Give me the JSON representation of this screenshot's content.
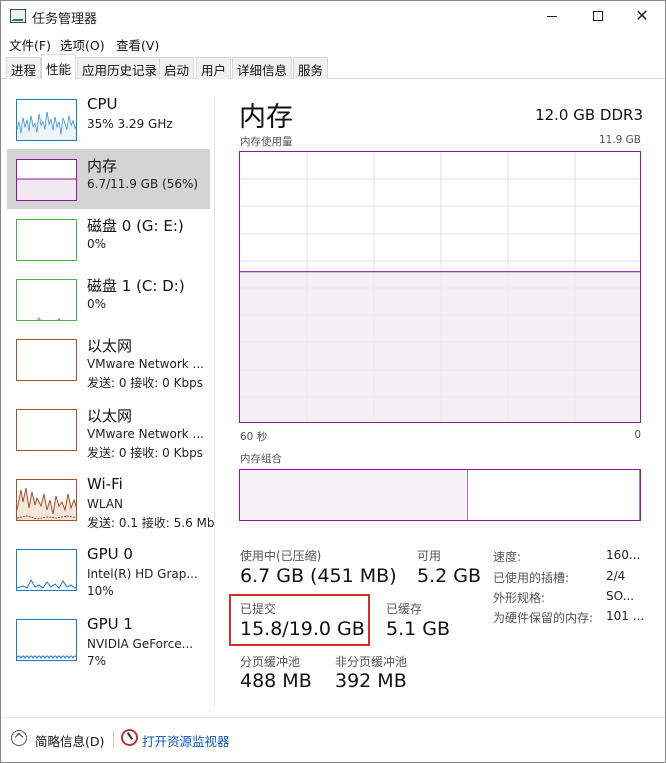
{
  "window": {
    "title": "任务管理器",
    "minimize_glyph": "—",
    "maximize_glyph": "☐",
    "close_glyph": "✕"
  },
  "menu": {
    "items": [
      "文件(F)",
      "选项(O)",
      "查看(V)"
    ]
  },
  "tabs": [
    {
      "label": "进程",
      "active": false
    },
    {
      "label": "性能",
      "active": true
    },
    {
      "label": "应用历史记录",
      "active": false
    },
    {
      "label": "启动",
      "active": false
    },
    {
      "label": "用户",
      "active": false
    },
    {
      "label": "详细信息",
      "active": false
    },
    {
      "label": "服务",
      "active": false
    }
  ],
  "sidebar": {
    "items": [
      {
        "title": "CPU",
        "line1": "35% 3.29 GHz",
        "line2": "",
        "color": "#1a7cc7",
        "icon": "cpu-graph-icon"
      },
      {
        "title": "内存",
        "line1": "6.7/11.9 GB (56%)",
        "line2": "",
        "color": "#8b1a9b",
        "icon": "memory-graph-icon",
        "selected": true
      },
      {
        "title": "磁盘 0 (G: E:)",
        "line1": "0%",
        "line2": "",
        "color": "#4caf50",
        "icon": "disk-graph-icon"
      },
      {
        "title": "磁盘 1 (C: D:)",
        "line1": "0%",
        "line2": "",
        "color": "#4caf50",
        "icon": "disk-graph-icon"
      },
      {
        "title": "以太网",
        "line1": "VMware Network ...",
        "line2": "发送: 0 接收: 0 Kbps",
        "color": "#a0522d",
        "icon": "ethernet-graph-icon"
      },
      {
        "title": "以太网",
        "line1": "VMware Network ...",
        "line2": "发送: 0 接收: 0 Kbps",
        "color": "#a0522d",
        "icon": "ethernet-graph-icon"
      },
      {
        "title": "Wi-Fi",
        "line1": "WLAN",
        "line2": "发送: 0.1 接收: 5.6 Mb",
        "color": "#a0522d",
        "icon": "wifi-graph-icon"
      },
      {
        "title": "GPU 0",
        "line1": "Intel(R) HD Grap...",
        "line2": "10%",
        "color": "#1a7cc7",
        "icon": "gpu-graph-icon"
      },
      {
        "title": "GPU 1",
        "line1": "NVIDIA GeForce...",
        "line2": "7%",
        "color": "#1a7cc7",
        "icon": "gpu-graph-icon"
      }
    ]
  },
  "panel": {
    "title": "内存",
    "spec": "12.0 GB DDR3",
    "usage_label": "内存使用量",
    "usage_max": "11.9 GB",
    "time_left": "60 秒",
    "time_right": "0",
    "usage_fraction": 0.56,
    "composition_label": "内存组合",
    "composition_in_use_fraction": 0.57,
    "stats": {
      "in_use_label": "使用中(已压缩)",
      "in_use_value": "6.7 GB (451 MB)",
      "available_label": "可用",
      "available_value": "5.2 GB",
      "committed_label": "已提交",
      "committed_value": "15.8/19.0 GB",
      "cached_label": "已缓存",
      "cached_value": "5.1 GB",
      "paged_label": "分页缓冲池",
      "paged_value": "488 MB",
      "nonpaged_label": "非分页缓冲池",
      "nonpaged_value": "392 MB"
    },
    "details": [
      {
        "key": "速度:",
        "value": "160..."
      },
      {
        "key": "已使用的插槽:",
        "value": "2/4"
      },
      {
        "key": "外形规格:",
        "value": "SO..."
      },
      {
        "key": "为硬件保留的内存:",
        "value": "101 ..."
      }
    ],
    "accent_color": "#8b1a9b",
    "highlight_color": "#d92b2b"
  },
  "bottom": {
    "fewer_details": "简略信息(D)",
    "open_monitor": "打开资源监视器"
  }
}
